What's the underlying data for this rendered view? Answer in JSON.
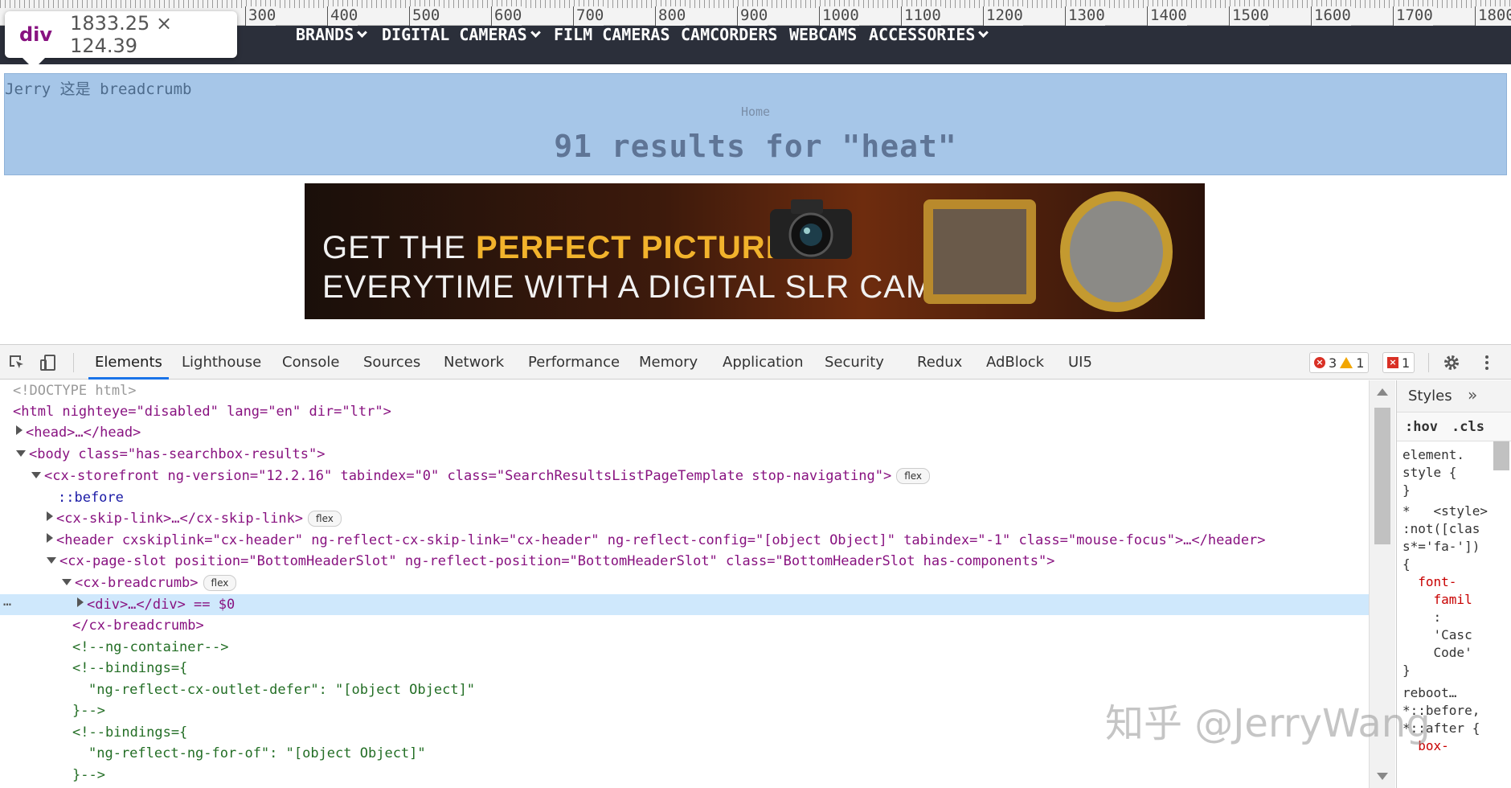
{
  "ruler": {
    "marks": [
      "300",
      "400",
      "500",
      "600",
      "700",
      "800",
      "900",
      "1000",
      "1100",
      "1200",
      "1300",
      "1400",
      "1500",
      "1600",
      "1700",
      "1800"
    ]
  },
  "tooltip": {
    "tag": "div",
    "dimensions": "1833.25 × 124.39"
  },
  "site_nav": {
    "items": [
      {
        "label": "BRANDS",
        "dropdown": true
      },
      {
        "label": "DIGITAL CAMERAS",
        "dropdown": true
      },
      {
        "label": "FILM CAMERAS",
        "dropdown": false
      },
      {
        "label": "CAMCORDERS",
        "dropdown": false
      },
      {
        "label": "WEBCAMS",
        "dropdown": false
      },
      {
        "label": "ACCESSORIES",
        "dropdown": true
      }
    ]
  },
  "breadcrumb": {
    "debug_text": "Jerry 这是 breadcrumb",
    "home": "Home",
    "title": "91 results for \"heat\""
  },
  "banner": {
    "line1_prefix": "GET THE ",
    "line1_highlight": "PERFECT PICTURE",
    "line2": "EVERYTIME WITH A DIGITAL SLR CAMERA"
  },
  "devtools": {
    "tabs": [
      "Elements",
      "Lighthouse",
      "Console",
      "Sources",
      "Network",
      "Performance",
      "Memory",
      "Application",
      "Security",
      "Redux",
      "AdBlock",
      "UI5"
    ],
    "active_tab": "Elements",
    "errors": "3",
    "warnings": "1",
    "issues": "1",
    "elements": [
      {
        "text": "<!DOCTYPE html>"
      },
      {
        "text": "<html nighteye=\"disabled\" lang=\"en\" dir=\"ltr\">"
      },
      {
        "text": "<head>…</head>"
      },
      {
        "text": "<body class=\"has-searchbox-results\">"
      },
      {
        "text": "<cx-storefront ng-version=\"12.2.16\" tabindex=\"0\" class=\"SearchResultsListPageTemplate stop-navigating\">",
        "pill": "flex"
      },
      {
        "text": "::before"
      },
      {
        "text": "<cx-skip-link>…</cx-skip-link>",
        "pill": "flex"
      },
      {
        "text": "<header cxskiplink=\"cx-header\" ng-reflect-cx-skip-link=\"cx-header\" ng-reflect-config=\"[object Object]\" tabindex=\"-1\" class=\"mouse-focus\">…</header>"
      },
      {
        "text": "<cx-page-slot position=\"BottomHeaderSlot\" ng-reflect-position=\"BottomHeaderSlot\" class=\"BottomHeaderSlot has-components\">"
      },
      {
        "text": "<cx-breadcrumb>",
        "pill": "flex"
      },
      {
        "text": "<div>…</div> == $0"
      },
      {
        "text": "</cx-breadcrumb>"
      },
      {
        "text": "<!--ng-container-->"
      },
      {
        "text": "<!--bindings={"
      },
      {
        "text": "\"ng-reflect-cx-outlet-defer\": \"[object Object]\""
      },
      {
        "text": "}-->"
      },
      {
        "text": "<!--bindings={"
      },
      {
        "text": "\"ng-reflect-ng-for-of\": \"[object Object]\""
      },
      {
        "text": "}-->"
      }
    ],
    "styles": {
      "tab": "Styles",
      "filter_hov": ":hov",
      "filter_cls": ".cls",
      "lines": [
        "element.",
        "style {",
        "}",
        "*   <style>",
        ":not([clas",
        "s*='fa-'])",
        "{",
        "  font-",
        "    famil",
        "    :",
        "    'Casc",
        "    Code'",
        "}",
        "reboot…",
        "*::before,",
        "*::after {",
        "  box-"
      ]
    }
  },
  "watermark": "知乎 @JerryWang"
}
